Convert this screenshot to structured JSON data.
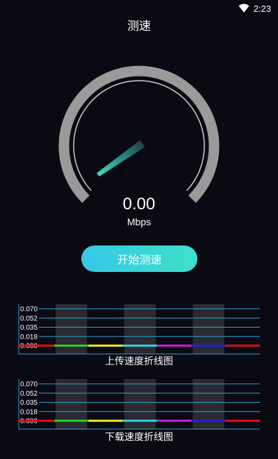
{
  "status_bar": {
    "time": "2:23",
    "wifi_icon": "wifi-icon"
  },
  "title": "测速",
  "gauge": {
    "value": "0.00",
    "unit": "Mbps",
    "level": 0
  },
  "start_button": {
    "label": "开始测速"
  },
  "colors": {
    "background": "#0a0a12",
    "gauge_track": "#9a9a9a",
    "needle_start": "#3ee0c8",
    "needle_end": "#1a3a40",
    "button_start": "#35c8e6",
    "button_end": "#3ee0c8",
    "grid_line": "#2aa6d6",
    "segments": [
      "#e01010",
      "#2ed02e",
      "#f0f030",
      "#30d8e8",
      "#d020d8",
      "#2020e0"
    ]
  },
  "chart_data": [
    {
      "type": "line",
      "caption": "上传速度折线图",
      "y_ticks": [
        "0.070",
        "0.052",
        "0.035",
        "0.018",
        "0.000"
      ],
      "ylim": [
        0,
        0.07
      ],
      "values": [
        0,
        0,
        0,
        0,
        0,
        0
      ]
    },
    {
      "type": "line",
      "caption": "下载速度折线图",
      "y_ticks": [
        "0.070",
        "0.052",
        "0.035",
        "0.018",
        "0.000"
      ],
      "ylim": [
        0,
        0.07
      ],
      "values": [
        0,
        0,
        0,
        0,
        0,
        0
      ]
    }
  ]
}
